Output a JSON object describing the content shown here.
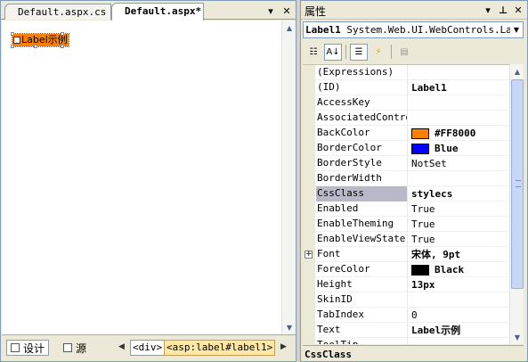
{
  "designer": {
    "tabs": [
      {
        "label": "Default.aspx.cs"
      },
      {
        "label": "Default.aspx*"
      }
    ],
    "label_text": "Label示例",
    "views": {
      "design": "设计",
      "source": "源"
    },
    "breadcrumbs": [
      "<div>",
      "<asp:label#label1>"
    ]
  },
  "properties": {
    "title": "属性",
    "object_name": "Label1",
    "object_type": "System.Web.UI.WebControls.Label",
    "rows": [
      {
        "name": "(Expressions)",
        "value": "",
        "bold": false
      },
      {
        "name": "(ID)",
        "value": "Label1",
        "bold": true
      },
      {
        "name": "AccessKey",
        "value": "",
        "bold": false
      },
      {
        "name": "AssociatedControl",
        "value": "",
        "bold": false
      },
      {
        "name": "BackColor",
        "value": "#FF8000",
        "bold": true,
        "swatch": "#FF8000"
      },
      {
        "name": "BorderColor",
        "value": "Blue",
        "bold": true,
        "swatch": "#0000FF"
      },
      {
        "name": "BorderStyle",
        "value": "NotSet",
        "bold": false
      },
      {
        "name": "BorderWidth",
        "value": "",
        "bold": false
      },
      {
        "name": "CssClass",
        "value": "stylecs",
        "bold": true,
        "selected": true
      },
      {
        "name": "Enabled",
        "value": "True",
        "bold": false
      },
      {
        "name": "EnableTheming",
        "value": "True",
        "bold": false
      },
      {
        "name": "EnableViewState",
        "value": "True",
        "bold": false
      },
      {
        "name": "Font",
        "value": "宋体, 9pt",
        "bold": true,
        "expandable": true
      },
      {
        "name": "ForeColor",
        "value": "Black",
        "bold": true,
        "swatch": "#000000"
      },
      {
        "name": "Height",
        "value": "13px",
        "bold": true
      },
      {
        "name": "SkinID",
        "value": "",
        "bold": false
      },
      {
        "name": "TabIndex",
        "value": "0",
        "bold": false
      },
      {
        "name": "Text",
        "value": "Label示例",
        "bold": true
      },
      {
        "name": "ToolTip",
        "value": "",
        "bold": false
      }
    ],
    "description_title": "CssClass"
  },
  "colors": {
    "label_back": "#FF8000",
    "selected_row": "#b8b8c8"
  }
}
